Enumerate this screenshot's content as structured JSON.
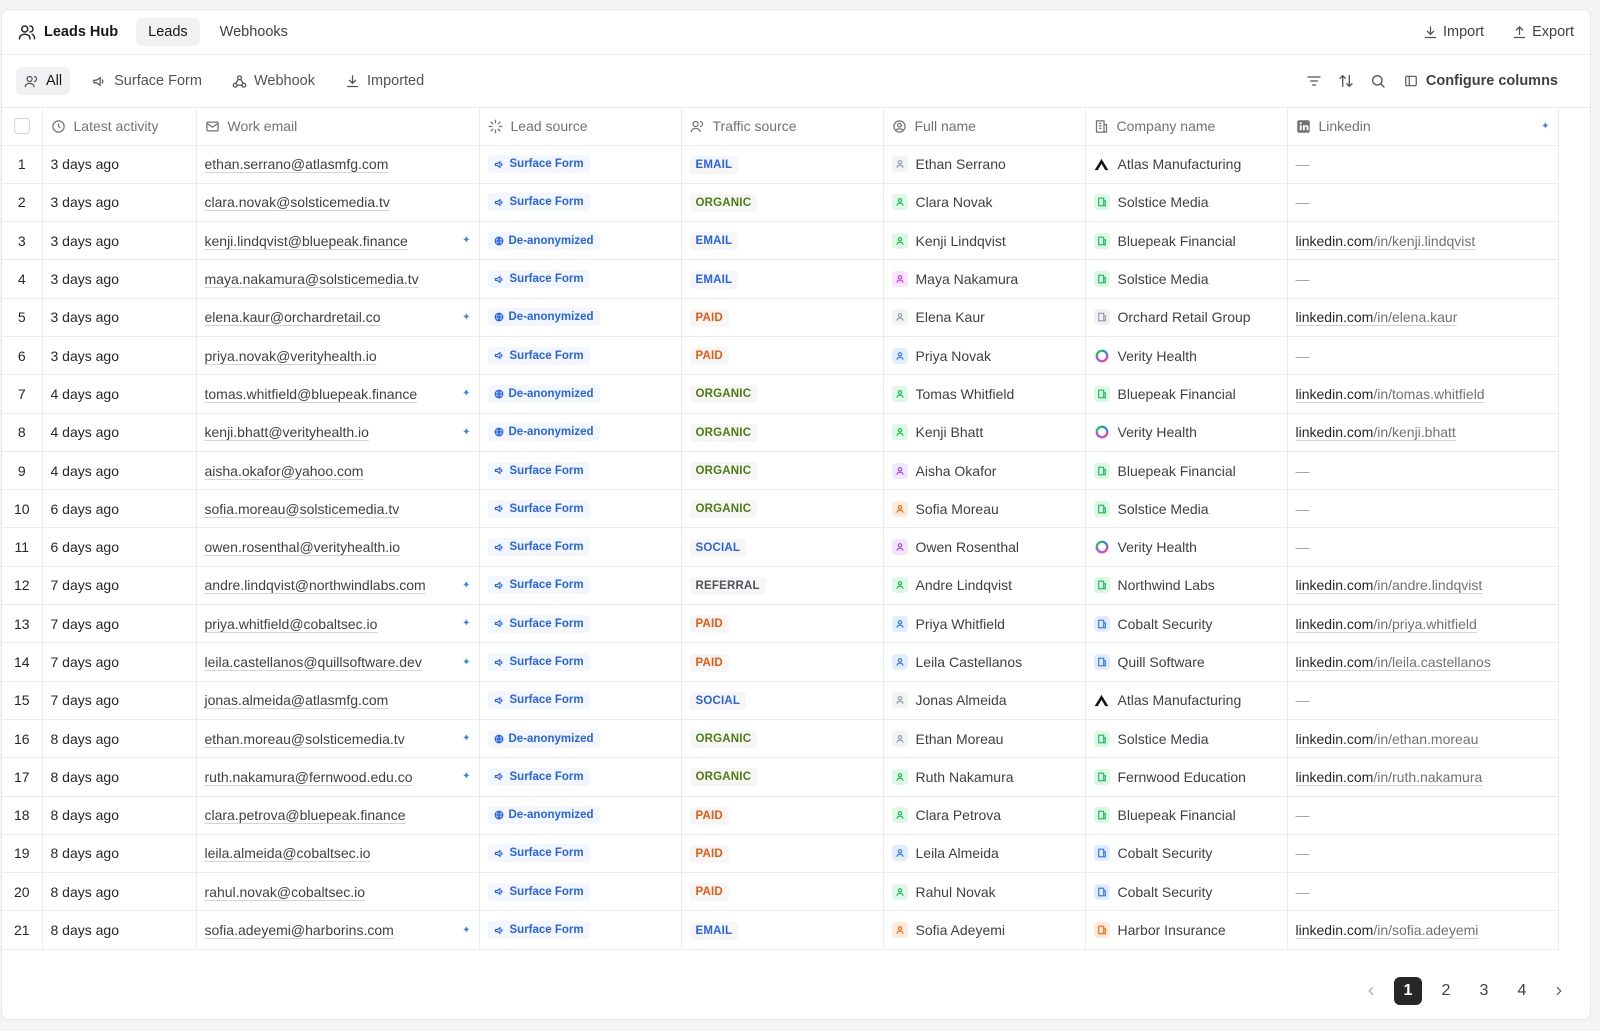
{
  "header": {
    "app_title": "Leads Hub",
    "tabs": [
      {
        "label": "Leads",
        "active": true
      },
      {
        "label": "Webhooks",
        "active": false
      }
    ],
    "import_label": "Import",
    "export_label": "Export"
  },
  "filters": {
    "chips": [
      {
        "label": "All",
        "icon": "users-icon",
        "active": true
      },
      {
        "label": "Surface Form",
        "icon": "megaphone-icon",
        "active": false
      },
      {
        "label": "Webhook",
        "icon": "webhook-icon",
        "active": false
      },
      {
        "label": "Imported",
        "icon": "download-icon",
        "active": false
      }
    ],
    "configure_label": "Configure columns"
  },
  "table": {
    "columns": [
      "Latest activity",
      "Work email",
      "Lead source",
      "Traffic source",
      "Full name",
      "Company name",
      "Linkedin"
    ],
    "rows": [
      {
        "n": "1",
        "activity": "3 days ago",
        "email": "ethan.serrano@atlasmfg.com",
        "enriched": false,
        "source": "Surface Form",
        "traffic": "EMAIL",
        "name": "Ethan Serrano",
        "company": "Atlas Manufacturing",
        "linkedin_domain": "",
        "linkedin_path": ""
      },
      {
        "n": "2",
        "activity": "3 days ago",
        "email": "clara.novak@solsticemedia.tv",
        "enriched": false,
        "source": "Surface Form",
        "traffic": "ORGANIC",
        "name": "Clara Novak",
        "company": "Solstice Media",
        "linkedin_domain": "",
        "linkedin_path": ""
      },
      {
        "n": "3",
        "activity": "3 days ago",
        "email": "kenji.lindqvist@bluepeak.finance",
        "enriched": true,
        "source": "De-anonymized",
        "traffic": "EMAIL",
        "name": "Kenji Lindqvist",
        "company": "Bluepeak Financial",
        "linkedin_domain": "linkedin.com",
        "linkedin_path": "/in/kenji.lindqvist"
      },
      {
        "n": "4",
        "activity": "3 days ago",
        "email": "maya.nakamura@solsticemedia.tv",
        "enriched": false,
        "source": "Surface Form",
        "traffic": "EMAIL",
        "name": "Maya Nakamura",
        "company": "Solstice Media",
        "linkedin_domain": "",
        "linkedin_path": ""
      },
      {
        "n": "5",
        "activity": "3 days ago",
        "email": "elena.kaur@orchardretail.co",
        "enriched": true,
        "source": "De-anonymized",
        "traffic": "PAID",
        "name": "Elena Kaur",
        "company": "Orchard Retail Group",
        "linkedin_domain": "linkedin.com",
        "linkedin_path": "/in/elena.kaur"
      },
      {
        "n": "6",
        "activity": "3 days ago",
        "email": "priya.novak@verityhealth.io",
        "enriched": false,
        "source": "Surface Form",
        "traffic": "PAID",
        "name": "Priya Novak",
        "company": "Verity Health",
        "linkedin_domain": "",
        "linkedin_path": ""
      },
      {
        "n": "7",
        "activity": "4 days ago",
        "email": "tomas.whitfield@bluepeak.finance",
        "enriched": true,
        "source": "De-anonymized",
        "traffic": "ORGANIC",
        "name": "Tomas Whitfield",
        "company": "Bluepeak Financial",
        "linkedin_domain": "linkedin.com",
        "linkedin_path": "/in/tomas.whitfield"
      },
      {
        "n": "8",
        "activity": "4 days ago",
        "email": "kenji.bhatt@verityhealth.io",
        "enriched": true,
        "source": "De-anonymized",
        "traffic": "ORGANIC",
        "name": "Kenji Bhatt",
        "company": "Verity Health",
        "linkedin_domain": "linkedin.com",
        "linkedin_path": "/in/kenji.bhatt"
      },
      {
        "n": "9",
        "activity": "4 days ago",
        "email": "aisha.okafor@yahoo.com",
        "enriched": false,
        "source": "Surface Form",
        "traffic": "ORGANIC",
        "name": "Aisha Okafor",
        "company": "Bluepeak Financial",
        "linkedin_domain": "",
        "linkedin_path": ""
      },
      {
        "n": "10",
        "activity": "6 days ago",
        "email": "sofia.moreau@solsticemedia.tv",
        "enriched": false,
        "source": "Surface Form",
        "traffic": "ORGANIC",
        "name": "Sofia Moreau",
        "company": "Solstice Media",
        "linkedin_domain": "",
        "linkedin_path": ""
      },
      {
        "n": "11",
        "activity": "6 days ago",
        "email": "owen.rosenthal@verityhealth.io",
        "enriched": false,
        "source": "Surface Form",
        "traffic": "SOCIAL",
        "name": "Owen Rosenthal",
        "company": "Verity Health",
        "linkedin_domain": "",
        "linkedin_path": ""
      },
      {
        "n": "12",
        "activity": "7 days ago",
        "email": "andre.lindqvist@northwindlabs.com",
        "enriched": true,
        "source": "Surface Form",
        "traffic": "REFERRAL",
        "name": "Andre Lindqvist",
        "company": "Northwind Labs",
        "linkedin_domain": "linkedin.com",
        "linkedin_path": "/in/andre.lindqvist"
      },
      {
        "n": "13",
        "activity": "7 days ago",
        "email": "priya.whitfield@cobaltsec.io",
        "enriched": true,
        "source": "Surface Form",
        "traffic": "PAID",
        "name": "Priya Whitfield",
        "company": "Cobalt Security",
        "linkedin_domain": "linkedin.com",
        "linkedin_path": "/in/priya.whitfield"
      },
      {
        "n": "14",
        "activity": "7 days ago",
        "email": "leila.castellanos@quillsoftware.dev",
        "enriched": true,
        "source": "Surface Form",
        "traffic": "PAID",
        "name": "Leila Castellanos",
        "company": "Quill Software",
        "linkedin_domain": "linkedin.com",
        "linkedin_path": "/in/leila.castellanos"
      },
      {
        "n": "15",
        "activity": "7 days ago",
        "email": "jonas.almeida@atlasmfg.com",
        "enriched": false,
        "source": "Surface Form",
        "traffic": "SOCIAL",
        "name": "Jonas Almeida",
        "company": "Atlas Manufacturing",
        "linkedin_domain": "",
        "linkedin_path": ""
      },
      {
        "n": "16",
        "activity": "8 days ago",
        "email": "ethan.moreau@solsticemedia.tv",
        "enriched": true,
        "source": "De-anonymized",
        "traffic": "ORGANIC",
        "name": "Ethan Moreau",
        "company": "Solstice Media",
        "linkedin_domain": "linkedin.com",
        "linkedin_path": "/in/ethan.moreau"
      },
      {
        "n": "17",
        "activity": "8 days ago",
        "email": "ruth.nakamura@fernwood.edu.co",
        "enriched": true,
        "source": "Surface Form",
        "traffic": "ORGANIC",
        "name": "Ruth Nakamura",
        "company": "Fernwood Education",
        "linkedin_domain": "linkedin.com",
        "linkedin_path": "/in/ruth.nakamura"
      },
      {
        "n": "18",
        "activity": "8 days ago",
        "email": "clara.petrova@bluepeak.finance",
        "enriched": false,
        "source": "De-anonymized",
        "traffic": "PAID",
        "name": "Clara Petrova",
        "company": "Bluepeak Financial",
        "linkedin_domain": "",
        "linkedin_path": ""
      },
      {
        "n": "19",
        "activity": "8 days ago",
        "email": "leila.almeida@cobaltsec.io",
        "enriched": false,
        "source": "Surface Form",
        "traffic": "PAID",
        "name": "Leila Almeida",
        "company": "Cobalt Security",
        "linkedin_domain": "",
        "linkedin_path": ""
      },
      {
        "n": "20",
        "activity": "8 days ago",
        "email": "rahul.novak@cobaltsec.io",
        "enriched": false,
        "source": "Surface Form",
        "traffic": "PAID",
        "name": "Rahul Novak",
        "company": "Cobalt Security",
        "linkedin_domain": "",
        "linkedin_path": ""
      },
      {
        "n": "21",
        "activity": "8 days ago",
        "email": "sofia.adeyemi@harborins.com",
        "enriched": true,
        "source": "Surface Form",
        "traffic": "EMAIL",
        "name": "Sofia Adeyemi",
        "company": "Harbor Insurance",
        "linkedin_domain": "linkedin.com",
        "linkedin_path": "/in/sofia.adeyemi"
      }
    ]
  },
  "pagination": {
    "pages": [
      "1",
      "2",
      "3",
      "4"
    ],
    "current": "1"
  },
  "colors": {
    "EMAIL": "#2563eb",
    "ORGANIC": "#4d7c0f",
    "PAID": "#ea580c",
    "SOCIAL": "#2563eb",
    "REFERRAL": "#52525b",
    "accent": "#2563eb"
  }
}
